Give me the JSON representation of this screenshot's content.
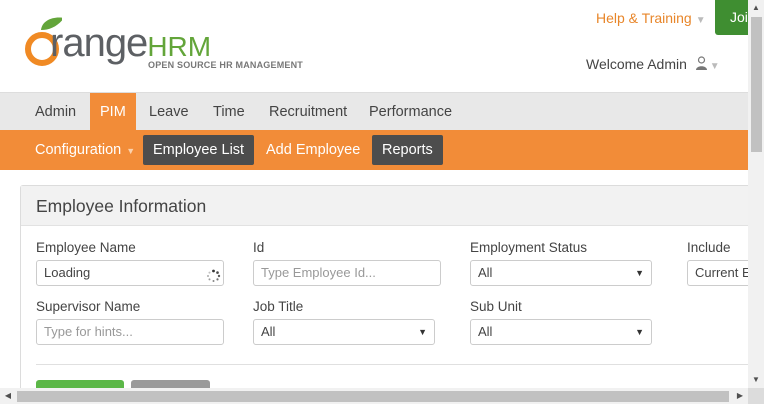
{
  "header": {
    "logo_word": "range",
    "logo_hrm": "HRM",
    "logo_tagline": "OPEN SOURCE HR MANAGEMENT",
    "help_label": "Help & Training",
    "help_caret": "▼",
    "join_label": "Join",
    "welcome_label": "Welcome Admin",
    "welcome_caret": "▼"
  },
  "main_menu": {
    "items": [
      {
        "label": "Admin"
      },
      {
        "label": "PIM"
      },
      {
        "label": "Leave"
      },
      {
        "label": "Time"
      },
      {
        "label": "Recruitment"
      },
      {
        "label": "Performance"
      }
    ],
    "active_index": 1
  },
  "sub_menu": {
    "items": [
      {
        "label": "Configuration",
        "caret": "▼"
      },
      {
        "label": "Employee List"
      },
      {
        "label": "Add Employee"
      },
      {
        "label": "Reports"
      }
    ]
  },
  "panel": {
    "title": "Employee Information",
    "fields": {
      "employee_name": {
        "label": "Employee Name",
        "value": "Loading"
      },
      "id": {
        "label": "Id",
        "placeholder": "Type Employee Id..."
      },
      "employment_status": {
        "label": "Employment Status",
        "value": "All"
      },
      "include": {
        "label": "Include",
        "value": "Current E"
      },
      "supervisor_name": {
        "label": "Supervisor Name",
        "placeholder": "Type for hints..."
      },
      "job_title": {
        "label": "Job Title",
        "value": "All"
      },
      "sub_unit": {
        "label": "Sub Unit",
        "value": "All"
      }
    }
  },
  "icons": {
    "user": "user-icon",
    "spinner": "loading-spinner-icon",
    "select_arrow": "chevron-down-icon"
  },
  "colors": {
    "brand_orange": "#f28c38",
    "brand_green": "#63a53a",
    "join_green": "#3f8e31",
    "submenu_dark": "#4d4d4d"
  }
}
